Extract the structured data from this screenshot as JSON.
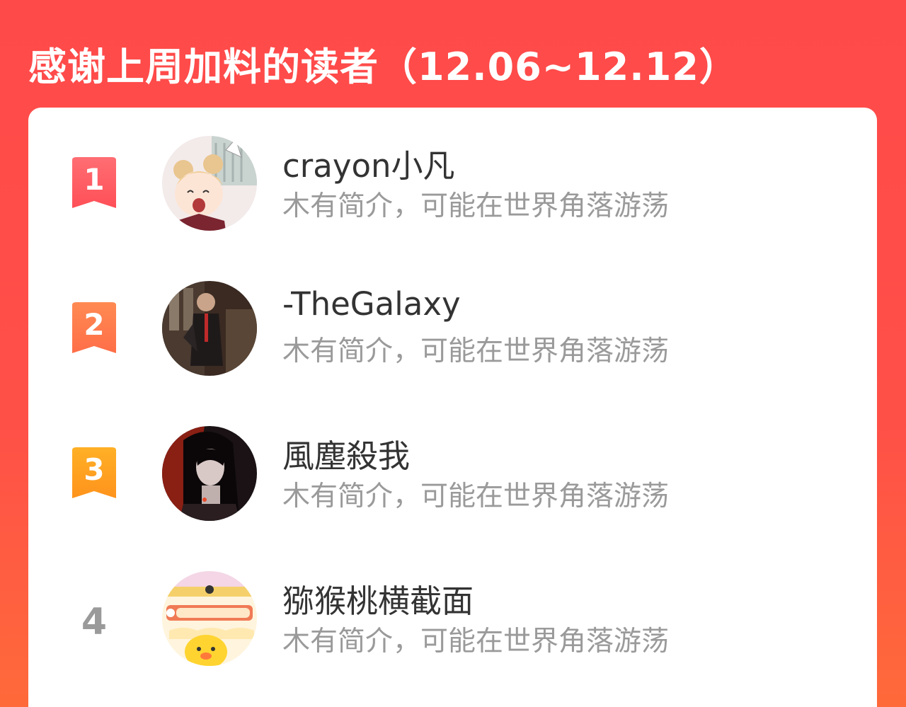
{
  "header": {
    "title": "感谢上周加料的读者（12.06~12.12）"
  },
  "readers": [
    {
      "rank": "1",
      "name": "crayon小凡",
      "bio": "木有简介，可能在世界角落游荡",
      "badge_color": "#ff5a5f",
      "avatar_icon": "anime-girl-avatar"
    },
    {
      "rank": "2",
      "name": "-TheGalaxy",
      "bio": "木有简介，可能在世界角落游荡",
      "badge_color": "#ff7d4d",
      "avatar_icon": "man-in-suit-avatar"
    },
    {
      "rank": "3",
      "name": "風塵殺我",
      "bio": "木有简介，可能在世界角落游荡",
      "badge_color": "#ffa21f",
      "avatar_icon": "dark-haired-figure-avatar"
    },
    {
      "rank": "4",
      "name": "猕猴桃横截面",
      "bio": "木有简介，可能在世界角落游荡",
      "badge_color": "#9a9a9a",
      "avatar_icon": "cartoon-chick-avatar"
    }
  ]
}
